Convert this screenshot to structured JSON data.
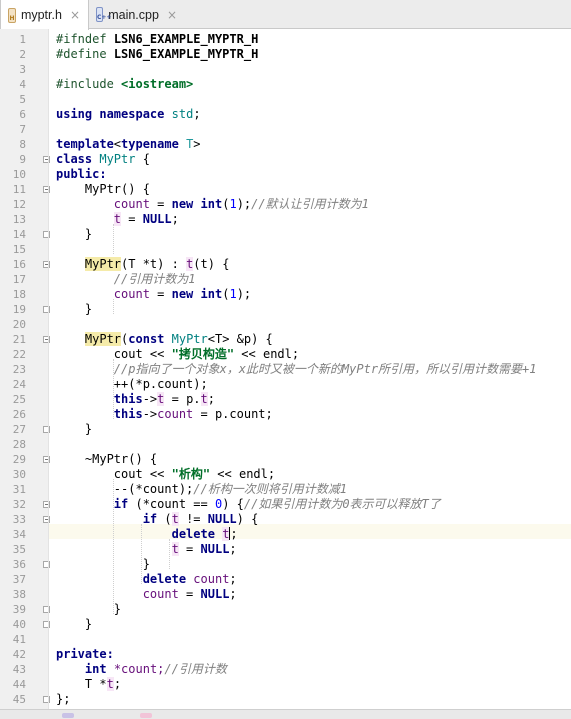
{
  "tabs": [
    {
      "name": "myptr.h",
      "icon": "h-file-icon",
      "icon_label": "H",
      "close": "×",
      "active": true
    },
    {
      "name": "main.cpp",
      "icon": "cpp-file-icon",
      "icon_label": "C++",
      "close": "×",
      "active": false
    }
  ],
  "lines": [
    "1",
    "2",
    "3",
    "4",
    "5",
    "6",
    "7",
    "8",
    "9",
    "10",
    "11",
    "12",
    "13",
    "14",
    "15",
    "16",
    "17",
    "18",
    "19",
    "20",
    "21",
    "22",
    "23",
    "24",
    "25",
    "26",
    "27",
    "28",
    "29",
    "30",
    "31",
    "32",
    "33",
    "34",
    "35",
    "36",
    "37",
    "38",
    "39",
    "40",
    "41",
    "42",
    "43",
    "44",
    "45"
  ],
  "code": {
    "ifndef": "#ifndef",
    "guard_macro": "LSN6_EXAMPLE_MYPTR_H",
    "define": "#define",
    "include": "#include",
    "iostream": "<iostream>",
    "using": "using",
    "namespace": "namespace",
    "std": "std",
    "semi": ";",
    "template": "template",
    "typename": "typename",
    "T": "T",
    "class": "class",
    "MyPtr": "MyPtr",
    "lbrace": "{",
    "rbrace": "}",
    "public": "public:",
    "private": "private:",
    "ctor_default": "MyPtr() {",
    "count": "count",
    "eq_new": " = ",
    "new": "new",
    "int": "int",
    "one": "1",
    "paren_end_semi": ");",
    "comment_12": "//默认让引用计数为1",
    "t": "t",
    "eq": " = ",
    "NULL": "NULL",
    "ctor_t_args": "(T *t) : ",
    "t_init": "(t) {",
    "comment_17": "//引用计数为1",
    "const": "const",
    "copy_args_a": "<T> &p) {",
    "cout": "cout",
    "shl": " << ",
    "str_copy": "\"拷贝构造\"",
    "endl": "endl;",
    "comment_24": "//p指向了一个对象x，x此时又被一个新的MyPtr所引用，所以引用计数需要+1",
    "inc_pcount": "++(*p.count);",
    "this": "this",
    "arrow_t": "->",
    "eq_pt": " = p.",
    "eq_pcount": " = p.count;",
    "dtor": "~MyPtr() {",
    "str_dtor": "\"析构\"",
    "dec_count": "--(*count);",
    "comment_31": "//析构一次则将引用计数减1",
    "if": "if",
    "if_open": " (*count == ",
    "zero": "0",
    "if_close": ") {",
    "comment_32": "//如果引用计数为0表示可以释放T了",
    "ne_null": " != ",
    "ne_close": ") {",
    "delete": "delete",
    "comment_43": "//引用计数",
    "count_decl": " *count;",
    "T_star": "T *",
    "end": "};"
  }
}
